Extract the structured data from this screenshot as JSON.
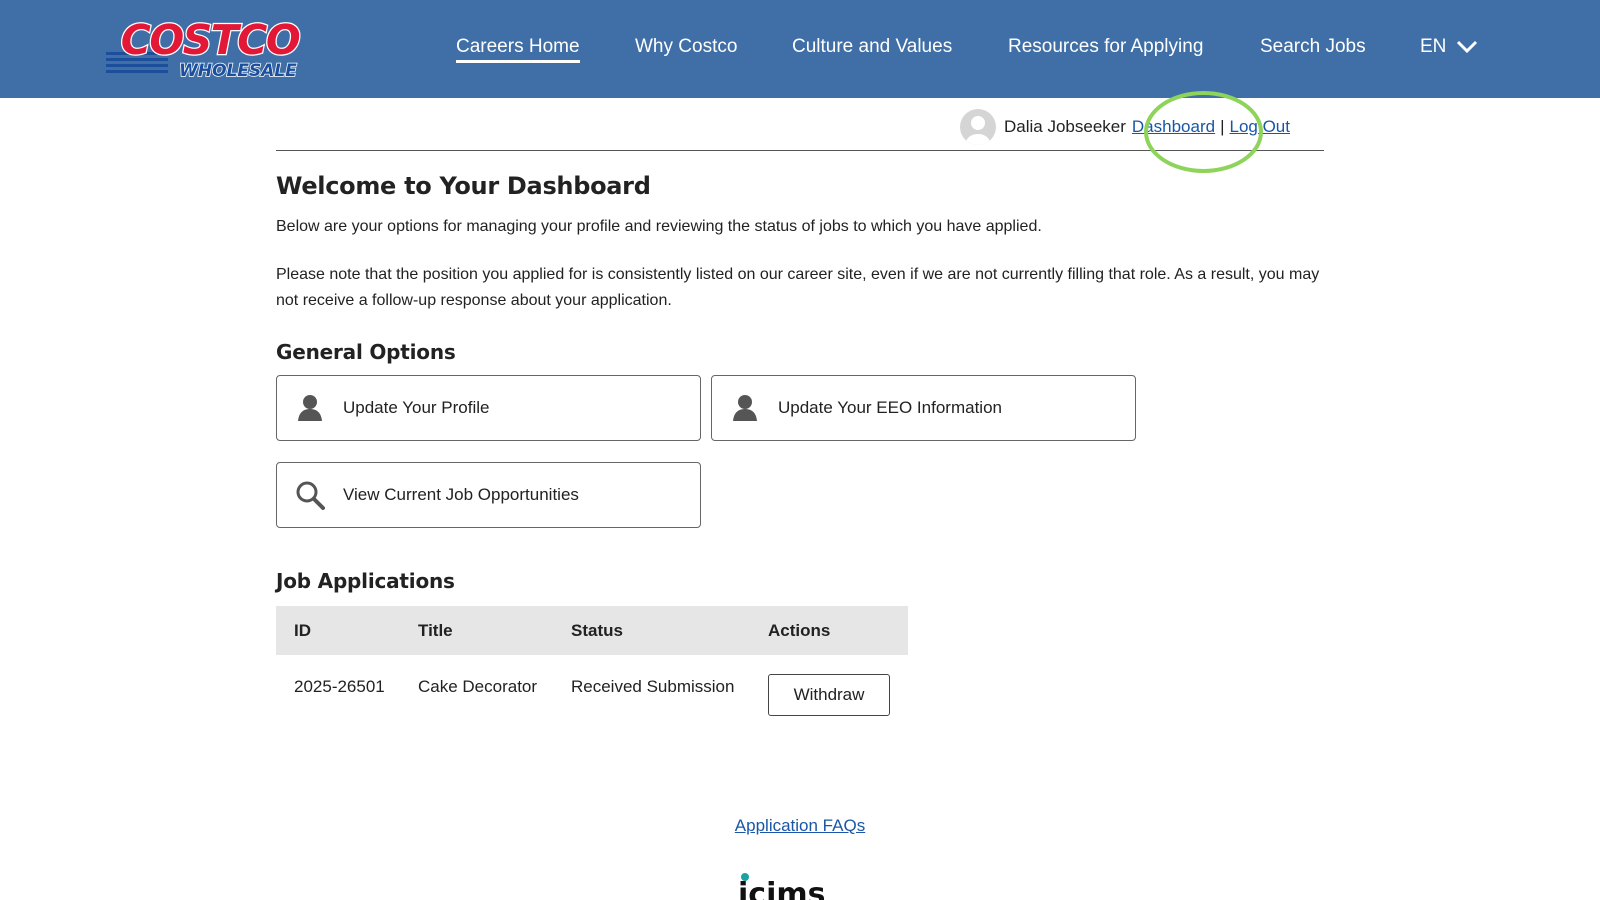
{
  "brand": {
    "logo_line1": "COSTCO",
    "logo_line2": "WHOLESALE",
    "red": "#e31837",
    "blue": "#1b4f9c"
  },
  "nav": {
    "items": [
      {
        "label": "Careers Home",
        "active": true
      },
      {
        "label": "Why Costco"
      },
      {
        "label": "Culture and Values"
      },
      {
        "label": "Resources for Applying"
      },
      {
        "label": "Search Jobs"
      }
    ],
    "language": "EN"
  },
  "user": {
    "name": "Dalia Jobseeker",
    "dashboard_link": "Dashboard",
    "separator": "|",
    "logout_link": "Log Out"
  },
  "page": {
    "title": "Welcome to Your Dashboard",
    "intro": "Below are your options for managing your profile and reviewing the status of jobs to which you have applied.",
    "note": "Please note that the position you applied for is consistently listed on our career site, even if we are not currently filling that role. As a result, you may not receive a follow-up response about your application."
  },
  "general_options": {
    "title": "General Options",
    "update_profile": "Update Your Profile",
    "update_eeo": "Update Your EEO Information",
    "view_jobs": "View Current Job Opportunities"
  },
  "job_applications": {
    "title": "Job Applications",
    "columns": {
      "id": "ID",
      "title": "Title",
      "status": "Status",
      "actions": "Actions"
    },
    "rows": [
      {
        "id": "2025-26501",
        "title": "Cake Decorator",
        "status": "Received Submission",
        "action_label": "Withdraw"
      }
    ]
  },
  "footer": {
    "faq_link": "Application FAQs",
    "vendor_logo": "icims"
  }
}
